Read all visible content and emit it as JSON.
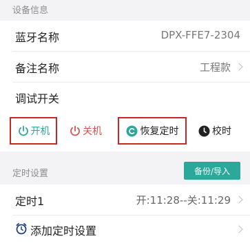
{
  "device_info": {
    "header": "设备信息",
    "bluetooth": {
      "label": "蓝牙名称",
      "value": "DPX-FFE7-2304"
    },
    "remark": {
      "label": "备注名称",
      "value": "工程款"
    }
  },
  "debug": {
    "title": "调试开关",
    "buttons": [
      {
        "label": "开机",
        "icon": "power-icon",
        "color": "#2ba89a",
        "highlighted": true
      },
      {
        "label": "关机",
        "icon": "power-icon",
        "color": "#d9534f",
        "highlighted": false
      },
      {
        "label": "恢复定时",
        "icon": "restore-icon",
        "color": "#2ba89a",
        "highlighted": true
      },
      {
        "label": "校时",
        "icon": "clock-sync-icon",
        "color": "#222222",
        "highlighted": false
      }
    ]
  },
  "timer": {
    "header": "定时设置",
    "import_label": "备份/导入",
    "item": {
      "label": "定时1",
      "value": "开:11:28--关:11:29"
    },
    "add_label": "添加定时设置"
  },
  "colors": {
    "accent": "#2ba89a",
    "highlight_border": "#c62828",
    "power_off": "#d9534f"
  }
}
